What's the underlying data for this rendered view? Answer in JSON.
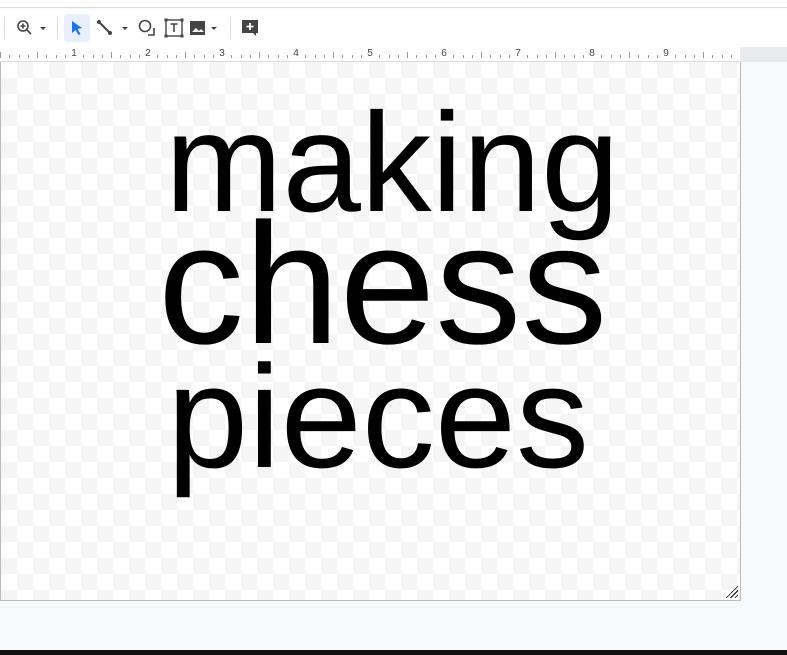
{
  "toolbar": {
    "icons": [
      "zoom-icon",
      "pointer-icon",
      "line-icon",
      "shape-icon",
      "textbox-icon",
      "image-icon",
      "add-comment-icon"
    ]
  },
  "ruler": {
    "numbers": [
      "1",
      "2",
      "3",
      "4",
      "5",
      "6",
      "7",
      "8",
      "9"
    ]
  },
  "drawing": {
    "lines": [
      "making",
      "chess",
      "pieces"
    ]
  },
  "colors": {
    "accent": "#1a73e8",
    "selected_bg": "#e8f0fe"
  }
}
